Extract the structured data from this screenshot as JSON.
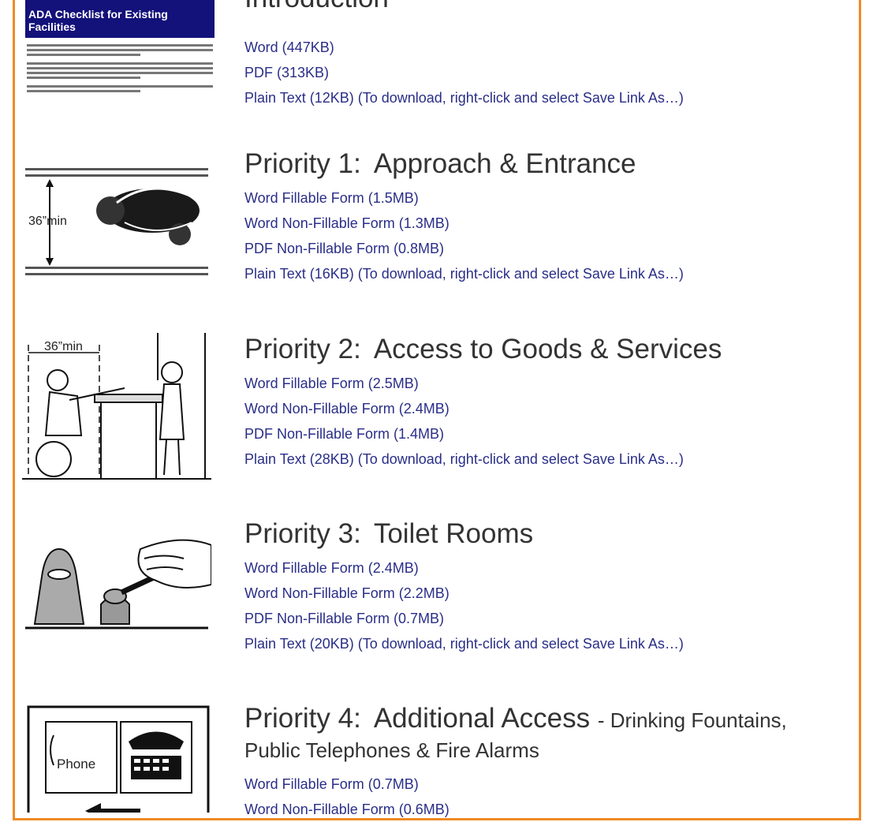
{
  "intro": {
    "title": "Introduction",
    "doc_title": "ADA Checklist for Existing Facilities",
    "links": [
      "Word (447KB)",
      "PDF (313KB)",
      "Plain Text (12KB) (To download, right-click and select Save Link As…)"
    ]
  },
  "priorities": [
    {
      "label": "Priority 1:",
      "title": "Approach & Entrance",
      "image_label": "36”min",
      "links": [
        "Word Fillable Form (1.5MB)",
        "Word Non-Fillable Form (1.3MB)",
        "PDF Non-Fillable Form (0.8MB)",
        "Plain Text (16KB) (To download, right-click and select Save Link As…)"
      ]
    },
    {
      "label": "Priority 2:",
      "title": "Access to Goods & Services",
      "image_label": "36”min",
      "links": [
        "Word Fillable Form (2.5MB)",
        "Word Non-Fillable Form (2.4MB)",
        "PDF Non-Fillable Form (1.4MB)",
        "Plain Text (28KB) (To download, right-click and select Save Link As…)"
      ]
    },
    {
      "label": "Priority 3:",
      "title": "Toilet Rooms",
      "links": [
        "Word Fillable Form (2.4MB)",
        "Word Non-Fillable Form (2.2MB)",
        "PDF Non-Fillable Form (0.7MB)",
        "Plain Text (20KB) (To download, right-click and select Save Link As…)"
      ]
    },
    {
      "label": "Priority 4:",
      "title": "Additional Access",
      "subtitle": "- Drinking Fountains,",
      "subtitle2": "Public Telephones & Fire Alarms",
      "image_label": "Phone",
      "links": [
        "Word Fillable Form (0.7MB)",
        "Word Non-Fillable Form (0.6MB)"
      ]
    }
  ],
  "colors": {
    "link": "#2a2e88",
    "border": "#f08a24",
    "doc_header": "#13117a"
  }
}
